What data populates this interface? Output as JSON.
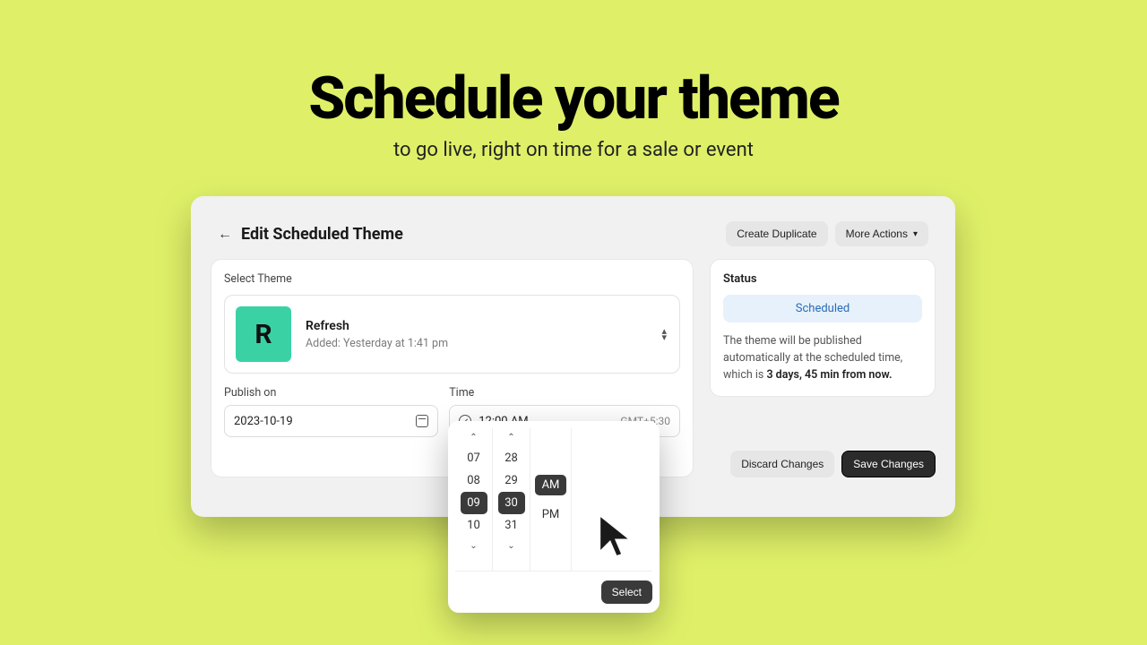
{
  "hero": {
    "title": "Schedule your theme",
    "subtitle": "to go live, right on time for a sale or event"
  },
  "header": {
    "page_title": "Edit Scheduled Theme",
    "create_duplicate": "Create Duplicate",
    "more_actions": "More Actions"
  },
  "theme_select": {
    "section_label": "Select Theme",
    "swatch_letter": "R",
    "name": "Refresh",
    "added_meta": "Added: Yesterday at 1:41 pm"
  },
  "publish": {
    "date_label": "Publish on",
    "date_value": "2023-10-19",
    "time_label": "Time",
    "time_value": "12:00 AM",
    "timezone": "GMT+5:30"
  },
  "time_picker": {
    "hours": [
      "07",
      "08",
      "09",
      "10"
    ],
    "selected_hour": "09",
    "minutes": [
      "28",
      "29",
      "30",
      "31"
    ],
    "selected_minute": "30",
    "ampm": [
      "AM",
      "PM"
    ],
    "selected_ampm": "AM",
    "select_label": "Select"
  },
  "status": {
    "label": "Status",
    "pill": "Scheduled",
    "desc_prefix": "The theme will be published automatically at the scheduled time, which is ",
    "desc_bold": "3 days, 45 min from now."
  },
  "actions": {
    "discard": "Discard Changes",
    "save": "Save Changes"
  }
}
